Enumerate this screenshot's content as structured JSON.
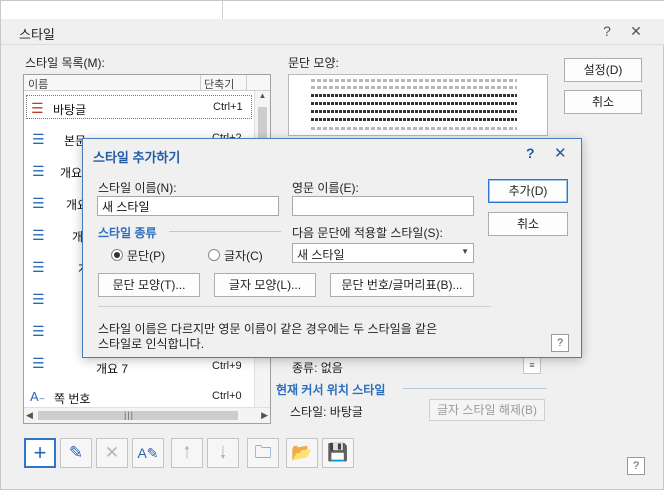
{
  "window": {
    "title": "스타일",
    "help": "?",
    "close": "✕"
  },
  "list": {
    "label": "스타일 목록(M):",
    "col_name": "이름",
    "col_key": "단축기",
    "items": [
      {
        "name": "바탕글",
        "key": "Ctrl+1"
      },
      {
        "name": "본문",
        "key": "Ctrl+2"
      },
      {
        "name": "개요",
        "key": ""
      },
      {
        "name": "개요",
        "key": ""
      },
      {
        "name": "개",
        "key": ""
      },
      {
        "name": "개",
        "key": ""
      },
      {
        "name": "",
        "key": ""
      },
      {
        "name": "",
        "key": ""
      },
      {
        "name": "",
        "key": ""
      },
      {
        "name": "개요 7",
        "key": "Ctrl+9"
      },
      {
        "name": "쪽 번호",
        "key": "Ctrl+0"
      }
    ],
    "hscroll_grip": "|||"
  },
  "preview": {
    "label": "문단 모양:"
  },
  "outer_buttons": {
    "settings": "설정(D)",
    "cancel": "취소"
  },
  "para_info": {
    "type": "종류: 없음"
  },
  "cursor_section": {
    "title": "현재 커서 위치 스타일",
    "style_text": "스타일: 바탕글",
    "release_button": "글자 스타일 해제(B)"
  },
  "toolbar": {
    "icons": [
      "plus-icon",
      "pencil-icon",
      "delete-icon",
      "edit-style-icon",
      "arrow-up-icon",
      "arrow-down-icon",
      "import-icon",
      "open-folder-icon",
      "save-icon"
    ]
  },
  "help_outer": "?",
  "dialog": {
    "title": "스타일 추가하기",
    "help": "?",
    "close": "✕",
    "style_name_label": "스타일 이름(N):",
    "style_name_value": "새 스타일",
    "eng_name_label": "영문 이름(E):",
    "eng_name_value": "",
    "add_button": "추가(D)",
    "cancel_button": "취소",
    "type_section": "스타일 종류",
    "radio_para": "문단(P)",
    "radio_char": "글자(C)",
    "next_label": "다음 문단에 적용할 스타일(S):",
    "next_value": "새 스타일",
    "btn_para_shape": "문단 모양(T)...",
    "btn_char_shape": "글자 모양(L)...",
    "btn_numbering": "문단 번호/글머리표(B)...",
    "note_line1": "스타일 이름은 다르지만 영문 이름이 같은 경우에는 두 스타일을 같은",
    "note_line2": "스타일로 인식합니다.",
    "help_small": "?"
  },
  "colors": {
    "accent": "#2a6ebf",
    "dialog_border": "#4a7cc2"
  }
}
